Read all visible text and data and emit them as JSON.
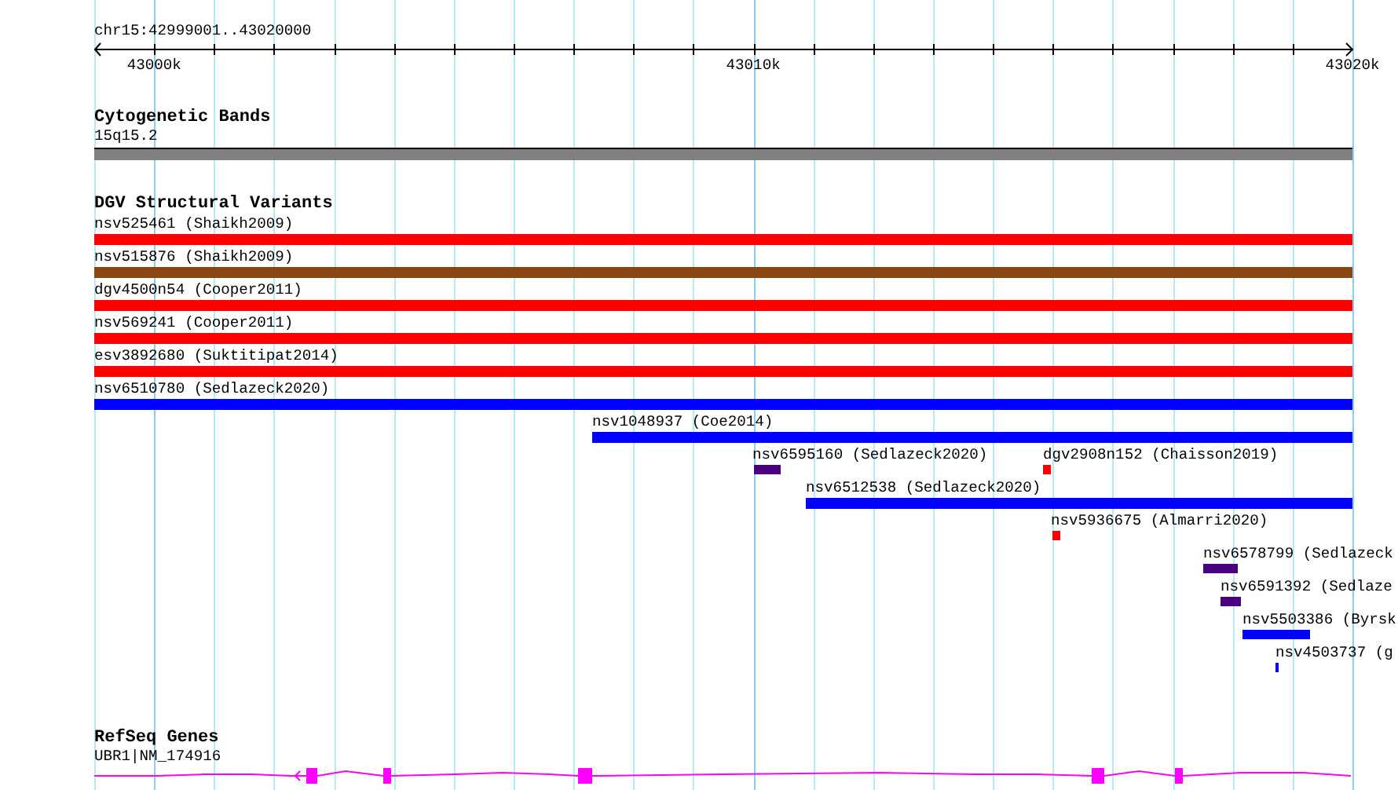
{
  "ruler": {
    "region": "chr15:42999001..43020000",
    "labels": [
      "43000k",
      "43010k",
      "43020k"
    ]
  },
  "cytogenetic_bands": {
    "title": "Cytogenetic Bands",
    "band": "15q15.2"
  },
  "dgv": {
    "title": "DGV Structural Variants",
    "rows": [
      {
        "variants": [
          {
            "label": "nsv525461 (Shaikh2009)",
            "color": "#ff0000"
          }
        ]
      },
      {
        "variants": [
          {
            "label": "nsv515876 (Shaikh2009)",
            "color": "#8b4513"
          }
        ]
      },
      {
        "variants": [
          {
            "label": "dgv4500n54 (Cooper2011)",
            "color": "#ff0000"
          }
        ]
      },
      {
        "variants": [
          {
            "label": "nsv569241 (Cooper2011)",
            "color": "#ff0000"
          }
        ]
      },
      {
        "variants": [
          {
            "label": "esv3892680 (Suktitipat2014)",
            "color": "#ff0000"
          }
        ]
      },
      {
        "variants": [
          {
            "label": "nsv6510780 (Sedlazeck2020)",
            "color": "#0000ff"
          }
        ]
      },
      {
        "variants": [
          {
            "label": "nsv1048937 (Coe2014)",
            "color": "#0000ff"
          }
        ]
      },
      {
        "variants": [
          {
            "label": "nsv6595160 (Sedlazeck2020)",
            "color": "#4b0082"
          },
          {
            "label": "dgv2908n152 (Chaisson2019)",
            "color": "#ff0000"
          }
        ]
      },
      {
        "variants": [
          {
            "label": "nsv6512538 (Sedlazeck2020)",
            "color": "#0000ff"
          }
        ]
      },
      {
        "variants": [
          {
            "label": "nsv5936675 (Almarri2020)",
            "color": "#ff0000"
          }
        ]
      },
      {
        "variants": [
          {
            "label": "nsv6578799 (Sedlazeck",
            "color": "#4b0082"
          }
        ]
      },
      {
        "variants": [
          {
            "label": "nsv6591392 (Sedlaze",
            "color": "#4b0082"
          }
        ]
      },
      {
        "variants": [
          {
            "label": "nsv5503386 (Byrsk",
            "color": "#0000ff"
          }
        ]
      },
      {
        "variants": [
          {
            "label": "nsv4503737 (g",
            "color": "#0000ff"
          }
        ]
      }
    ]
  },
  "refseq": {
    "title": "RefSeq Genes",
    "gene": "UBR1|NM_174916"
  }
}
